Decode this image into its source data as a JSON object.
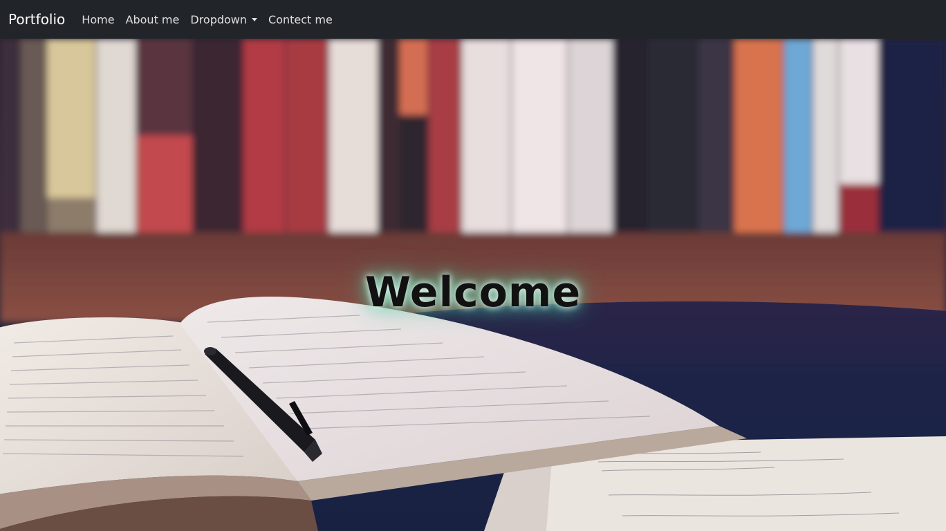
{
  "navbar": {
    "brand": "Portfolio",
    "items": [
      {
        "label": "Home"
      },
      {
        "label": "About me"
      },
      {
        "label": "Dropdown",
        "has_dropdown": true
      },
      {
        "label": "Contect me"
      }
    ]
  },
  "hero": {
    "heading": "Welcome",
    "background_description_icon": "bookshelf-and-open-book-photo",
    "glow_color": "#5fe0b8"
  },
  "colors": {
    "navbar_bg": "#212529",
    "navbar_text": "#ffffff"
  }
}
